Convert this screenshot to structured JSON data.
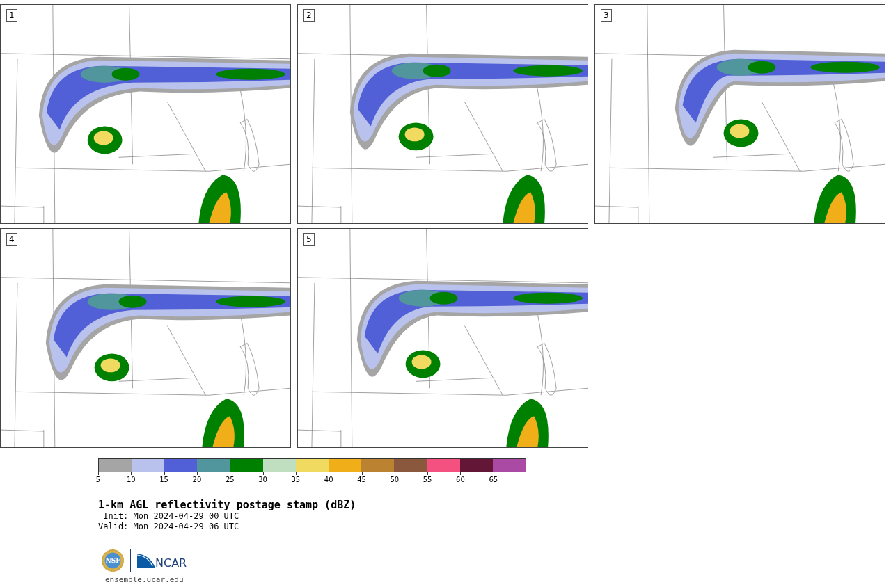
{
  "panels": [
    {
      "number": "1"
    },
    {
      "number": "2"
    },
    {
      "number": "3"
    },
    {
      "number": "4"
    },
    {
      "number": "5"
    }
  ],
  "colorbar": {
    "bins": [
      {
        "label": "5",
        "color": "#a5a5a5"
      },
      {
        "label": "10",
        "color": "#b9c2ec"
      },
      {
        "label": "15",
        "color": "#5160d6"
      },
      {
        "label": "20",
        "color": "#50969c"
      },
      {
        "label": "25",
        "color": "#008000"
      },
      {
        "label": "30",
        "color": "#c0dec0"
      },
      {
        "label": "35",
        "color": "#f0da60"
      },
      {
        "label": "40",
        "color": "#f0ae18"
      },
      {
        "label": "45",
        "color": "#bb8232"
      },
      {
        "label": "50",
        "color": "#8a583c"
      },
      {
        "label": "55",
        "color": "#f45080"
      },
      {
        "label": "60",
        "color": "#631636"
      },
      {
        "label": "65",
        "color": "#aa4aa4"
      }
    ]
  },
  "title": "1-km AGL reflectivity postage stamp (dBZ)",
  "init": " Init: Mon 2024-04-29 00 UTC",
  "valid": "Valid: Mon 2024-04-29 06 UTC",
  "logos": {
    "nsf": "NSF",
    "ncar": "NCAR"
  },
  "site": "ensemble.ucar.edu"
}
